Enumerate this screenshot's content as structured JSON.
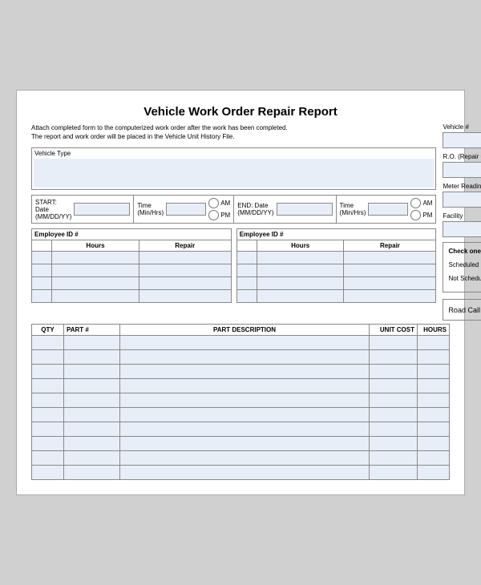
{
  "title": "Vehicle Work Order Repair Report",
  "instructions": {
    "line1": "Attach completed form to the computerized work order after the work has been completed.",
    "line2": "The report and work order will be placed in the Vehicle Unit History File."
  },
  "right_panel": {
    "vehicle_label": "Vehicle #",
    "ro_label": "R.O. (Repair Order) #",
    "meter_label": "Meter Reading",
    "facility_label": "Facility",
    "check_only_label": "Check one only",
    "scheduled_label": "Scheduled",
    "not_scheduled_label": "Not Scheduled",
    "road_call_label": "Road Call"
  },
  "vehicle_type_label": "Vehicle Type",
  "start_date_label": "START: Date (MM/DD/YY)",
  "start_time_label": "Time (Min/Hrs)",
  "end_date_label": "END: Date (MM/DD/YY)",
  "end_time_label": "Time (Min/Hrs)",
  "am_label": "AM",
  "pm_label": "PM",
  "employee_table": {
    "col_id": "Employee ID #",
    "col_hours": "Hours",
    "col_repair": "Repair",
    "rows": 4
  },
  "parts_table": {
    "col_qty": "QTY",
    "col_part": "PART #",
    "col_desc": "PART DESCRIPTION",
    "col_unit": "UNIT COST",
    "col_hours": "HOURS",
    "rows": 10
  }
}
